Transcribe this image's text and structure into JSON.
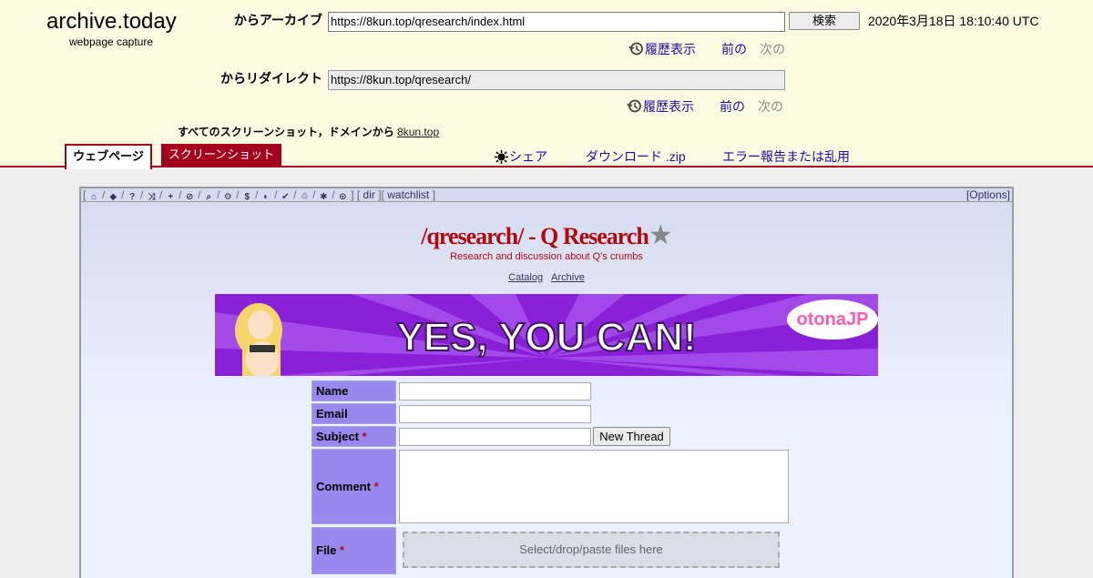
{
  "archive": {
    "logo_title": "archive.today",
    "logo_subtitle": "webpage capture",
    "archive_from_label": "からアーカイブ",
    "archive_url": "https://8kun.top/qresearch/index.html",
    "search_button": "検索",
    "timestamp": "2020年3月18日 18:10:40 UTC",
    "redirect_label": "からリダイレクト",
    "redirect_url": "https://8kun.top/qresearch/",
    "history_label": "履歴表示",
    "prev_label": "前の",
    "next_label": "次の",
    "all_screenshots_text": "すべてのスクリーンショット，ドメインから",
    "domain_link": "8kun.top",
    "tab_webpage": "ウェブページ",
    "tab_screenshot": "スクリーンショット",
    "share_label": "シェア",
    "download_label": "ダウンロード .zip",
    "report_label": "エラー報告または乱用",
    "accent_color": "#a4011e",
    "header_bg": "#fefbe3"
  },
  "board": {
    "toolbar_icons": [
      "home-icon",
      "tags-icon",
      "question-icon",
      "shuffle-icon",
      "plus-icon",
      "ban-icon",
      "search-icon",
      "gear-icon",
      "dollar-icon",
      "contrast-icon",
      "twitter-icon",
      "recycle-icon",
      "bug-icon",
      "check-circle-icon"
    ],
    "dir_link": "dir",
    "watchlist_link": "watchlist",
    "options_link": "[Options]",
    "title": "/qresearch/ - Q Research",
    "subtitle": "Research and discussion about Q's crumbs",
    "catalog_link": "Catalog",
    "archive_link": "Archive",
    "banner_text": "YES, YOU CAN!",
    "banner_logo_text": "otonaJP",
    "title_color": "#af0a0f"
  },
  "form": {
    "name_label": "Name",
    "email_label": "Email",
    "subject_label": "Subject",
    "comment_label": "Comment",
    "file_label": "File",
    "required_mark": "*",
    "new_thread_button": "New Thread",
    "drop_text": "Select/drop/paste files here"
  }
}
